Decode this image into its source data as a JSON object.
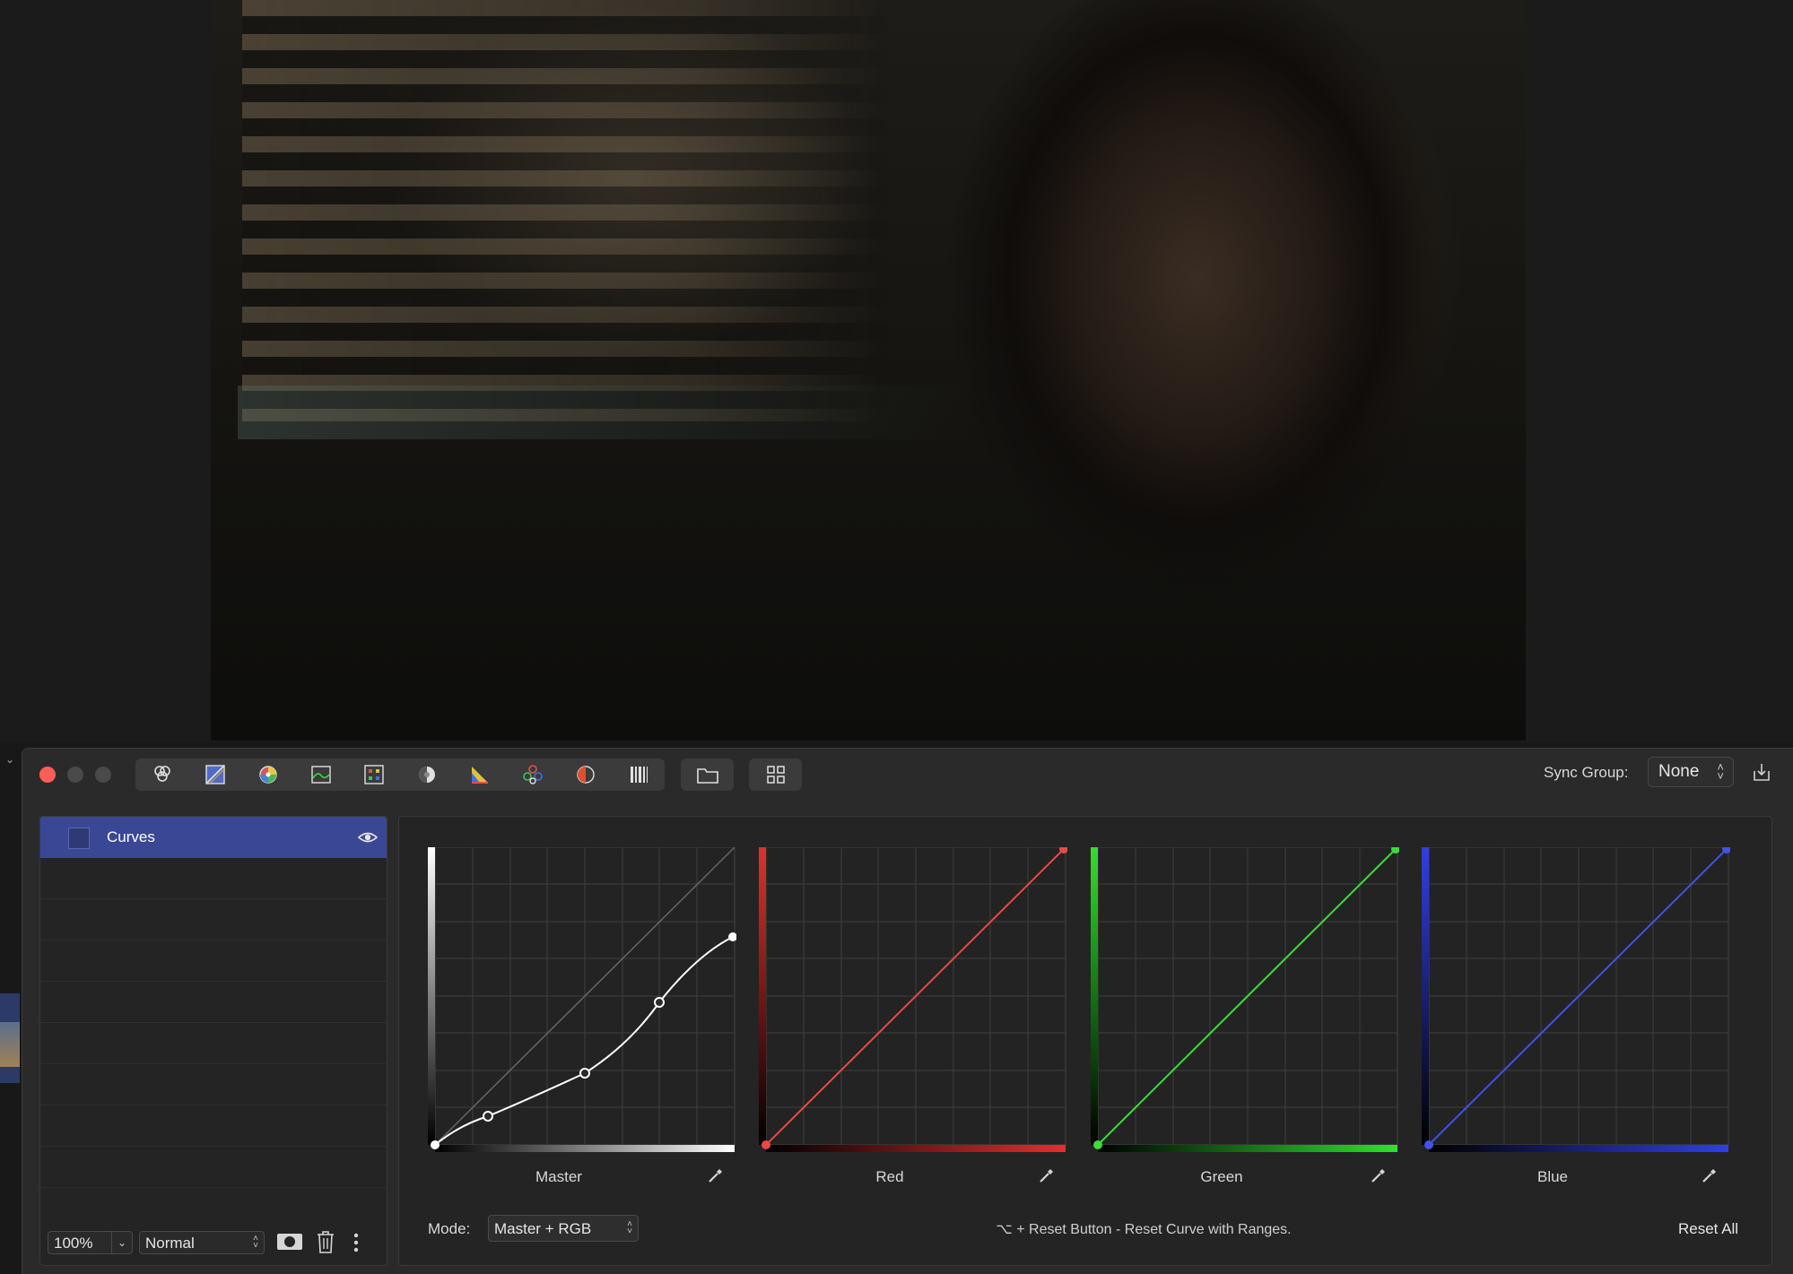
{
  "toolbar": {
    "sync_group_label": "Sync Group:",
    "sync_group_value": "None",
    "tools": [
      "color-wheels-icon",
      "curves-icon",
      "hue-sat-icon",
      "levels-icon",
      "lut-icon",
      "exposure-icon",
      "scopes-icon",
      "color-balance-icon",
      "contrast-icon",
      "barcode-icon"
    ],
    "extra_tools": [
      "folder-icon",
      "grid-icon"
    ]
  },
  "layers": {
    "items": [
      {
        "label": "Curves",
        "visible": true
      }
    ],
    "zoom_value": "100%",
    "blend_mode": "Normal"
  },
  "curves": {
    "panels": [
      {
        "label": "Master",
        "color": "#ffffff"
      },
      {
        "label": "Red",
        "color": "#e84a45"
      },
      {
        "label": "Green",
        "color": "#3bdc3b"
      },
      {
        "label": "Blue",
        "color": "#4253e6"
      }
    ],
    "mode_label": "Mode:",
    "mode_value": "Master + RGB",
    "hint": "⌥ + Reset Button - Reset Curve with Ranges.",
    "reset_all_label": "Reset All"
  }
}
